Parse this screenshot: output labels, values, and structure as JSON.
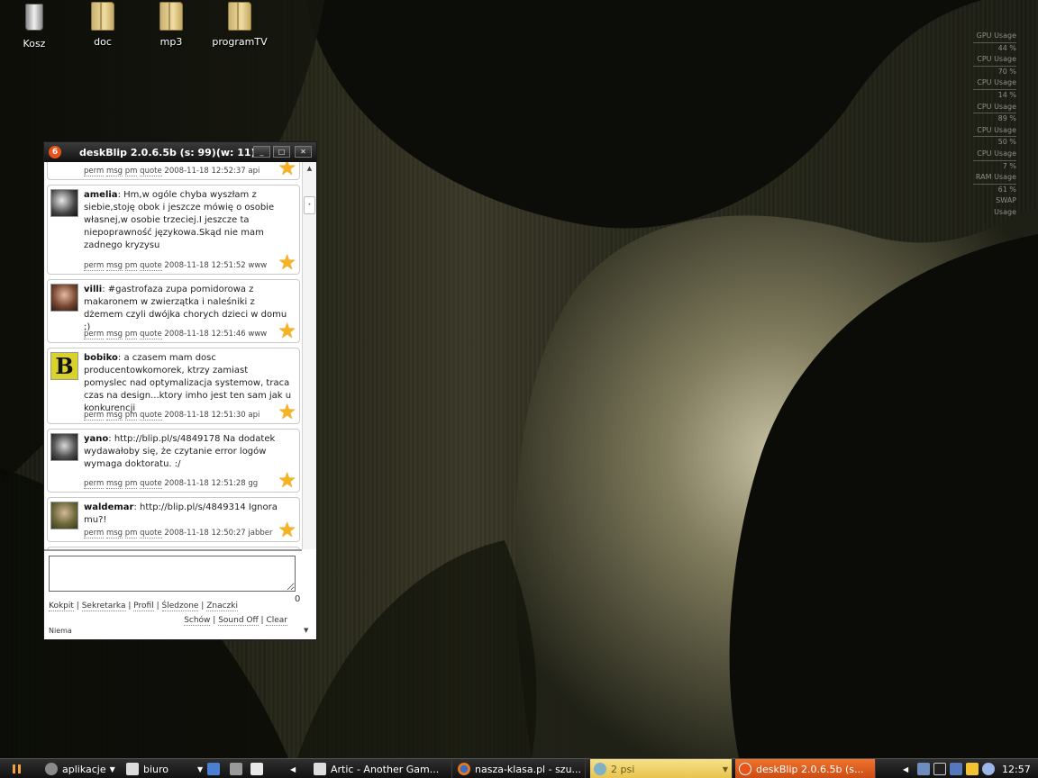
{
  "desktop": {
    "icons": [
      {
        "label": "Kosz"
      },
      {
        "label": "doc"
      },
      {
        "label": "mp3"
      },
      {
        "label": "programTV"
      }
    ],
    "monitor": [
      {
        "label": "GPU Usage",
        "value": "44 %"
      },
      {
        "label": "CPU Usage",
        "value": "70 %"
      },
      {
        "label": "CPU Usage",
        "value": "14 %"
      },
      {
        "label": "CPU Usage",
        "value": "89 %"
      },
      {
        "label": "CPU Usage",
        "value": "50 %"
      },
      {
        "label": "CPU Usage",
        "value": "7 %"
      },
      {
        "label": "RAM Usage",
        "value": "61 %"
      },
      {
        "label": "SWAP Usage",
        "value": ""
      }
    ]
  },
  "window": {
    "title": "deskBlip 2.0.6.5b (s: 99)(w: 11)",
    "logo": "6",
    "buttons": {
      "minimize": "_",
      "maximize": "□",
      "close": "✕"
    },
    "links": {
      "perm": "perm",
      "msg": "msg",
      "pm": "pm",
      "quote": "quote"
    },
    "posts": [
      {
        "user": "",
        "text": "",
        "timestamp": "2008-11-18 12:52:37",
        "source": "api"
      },
      {
        "user": "amelia",
        "text": "Hm,w ogóle chyba wyszłam z siebie,stoję obok i jeszcze mówię o osobie własnej,w osobie trzeciej.I jeszcze ta niepoprawność językowa.Skąd nie mam zadnego kryzysu",
        "timestamp": "2008-11-18 12:51:52",
        "source": "www"
      },
      {
        "user": "villi",
        "text": "#gastrofaza zupa pomidorowa z makaronem w zwierzątka i naleśniki z dżemem czyli dwójka chorych dzieci w domu ;)",
        "timestamp": "2008-11-18 12:51:46",
        "source": "www"
      },
      {
        "user": "bobiko",
        "text": "a czasem mam dosc producentowkomorek, ktrzy zamiast pomyslec nad optymalizacja systemow, traca czas na design...ktory imho jest ten sam jak u konkurencji",
        "timestamp": "2008-11-18 12:51:30",
        "source": "api"
      },
      {
        "user": "yano",
        "text": "http://blip.pl/s/4849178 Na dodatek wydawałoby się, że czytanie error logów wymaga doktoratu. :/",
        "timestamp": "2008-11-18 12:51:28",
        "source": "gg"
      },
      {
        "user": "waldemar",
        "text": "http://blip.pl/s/4849314 Ignora mu?!",
        "timestamp": "2008-11-18 12:50:27",
        "source": "jabber"
      }
    ],
    "compose": {
      "placeholder": "",
      "count": "0"
    },
    "nav": [
      "Kokpit",
      "Sekretarka",
      "Profil",
      "Śledzone",
      "Znaczki"
    ],
    "options": [
      "Schów",
      "Sound Off",
      "Clear"
    ],
    "status": "Niema"
  },
  "taskbar": {
    "menu_apps": "aplikacje",
    "menu_office": "biuro",
    "tasks": [
      {
        "label": "Artic - Another Gam..."
      },
      {
        "label": "nasza-klasa.pl - szu..."
      },
      {
        "label": "2 psi"
      },
      {
        "label": "deskBlip 2.0.6.5b (s..."
      }
    ],
    "clock": "12:57"
  },
  "colors": {
    "accent": "#e8531c",
    "star": "#f7b21f",
    "psi": "#e6c34a"
  }
}
